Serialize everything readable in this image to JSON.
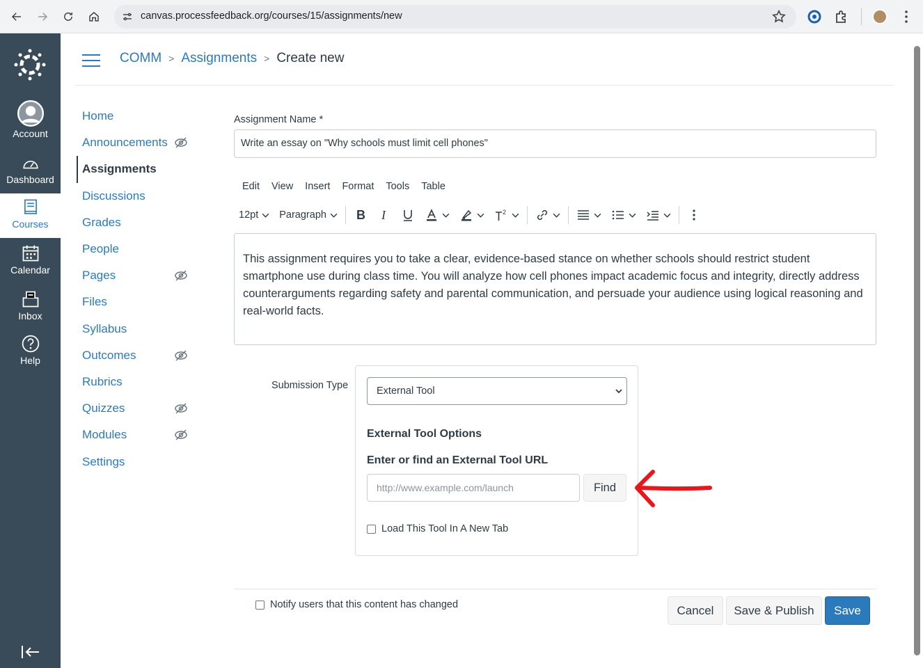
{
  "browser": {
    "url": "canvas.processfeedback.org/courses/15/assignments/new"
  },
  "global_nav": {
    "items": [
      {
        "label": "Account"
      },
      {
        "label": "Dashboard"
      },
      {
        "label": "Courses"
      },
      {
        "label": "Calendar"
      },
      {
        "label": "Inbox"
      },
      {
        "label": "Help"
      }
    ],
    "active": "Courses"
  },
  "breadcrumb": {
    "course": "COMM",
    "section": "Assignments",
    "current": "Create new"
  },
  "course_nav": {
    "items": [
      {
        "label": "Home",
        "hidden": false
      },
      {
        "label": "Announcements",
        "hidden": true
      },
      {
        "label": "Assignments",
        "hidden": false
      },
      {
        "label": "Discussions",
        "hidden": false
      },
      {
        "label": "Grades",
        "hidden": false
      },
      {
        "label": "People",
        "hidden": false
      },
      {
        "label": "Pages",
        "hidden": true
      },
      {
        "label": "Files",
        "hidden": false
      },
      {
        "label": "Syllabus",
        "hidden": false
      },
      {
        "label": "Outcomes",
        "hidden": true
      },
      {
        "label": "Rubrics",
        "hidden": false
      },
      {
        "label": "Quizzes",
        "hidden": true
      },
      {
        "label": "Modules",
        "hidden": true
      },
      {
        "label": "Settings",
        "hidden": false
      }
    ],
    "active": "Assignments"
  },
  "form": {
    "name_label": "Assignment Name *",
    "name_value": "Write an essay on \"Why schools must limit cell phones\"",
    "menubar": [
      "Edit",
      "View",
      "Insert",
      "Format",
      "Tools",
      "Table"
    ],
    "font_size": "12pt",
    "block_format": "Paragraph",
    "body": "This assignment requires you to take a clear, evidence-based stance on whether schools should restrict student smartphone use during class time. You will analyze how cell phones impact academic focus and integrity, directly address counterarguments regarding safety and parental communication, and persuade your audience using logical reasoning and real-world facts.",
    "submission_type_label": "Submission Type",
    "submission_type_value": "External Tool",
    "external_tool_options": "External Tool Options",
    "external_tool_url_label": "Enter or find an External Tool URL",
    "external_tool_url_placeholder": "http://www.example.com/launch",
    "find_label": "Find",
    "new_tab_label": "Load This Tool In A New Tab",
    "notify_label": "Notify users that this content has changed"
  },
  "actions": {
    "cancel": "Cancel",
    "save_publish": "Save & Publish",
    "save": "Save"
  },
  "colors": {
    "brand": "#2b7abc",
    "nav_bg": "#394b58",
    "annotation_arrow": "#e8171e"
  }
}
